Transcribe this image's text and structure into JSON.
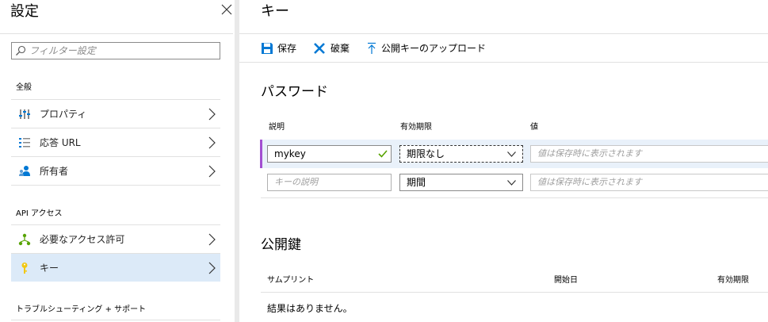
{
  "left_blade": {
    "title": "設定",
    "filter_placeholder": "フィルター設定",
    "sections": [
      {
        "title": "全般",
        "items": [
          {
            "label": "プロパティ",
            "icon": "properties-icon"
          },
          {
            "label": "応答 URL",
            "icon": "list-icon"
          },
          {
            "label": "所有者",
            "icon": "owners-icon"
          }
        ]
      },
      {
        "title": "API アクセス",
        "items": [
          {
            "label": "必要なアクセス許可",
            "icon": "permissions-icon"
          },
          {
            "label": "キー",
            "icon": "key-icon",
            "active": true
          }
        ]
      },
      {
        "title": "トラブルシューティング + サポート",
        "items": []
      }
    ]
  },
  "right_blade": {
    "title": "キー",
    "toolbar": {
      "save_label": "保存",
      "discard_label": "破棄",
      "upload_label": "公開キーのアップロード"
    },
    "passwords": {
      "heading": "パスワード",
      "columns": {
        "description": "説明",
        "expires": "有効期限",
        "value": "値"
      },
      "rows": [
        {
          "description": "mykey",
          "expires": "期限なし",
          "value_placeholder": "値は保存時に表示されます"
        },
        {
          "description_placeholder": "キーの説明",
          "expires": "期間",
          "value_placeholder": "値は保存時に表示されます"
        }
      ]
    },
    "public_keys": {
      "heading": "公開鍵",
      "columns": {
        "thumbprint": "サムプリント",
        "start_date": "開始日",
        "expires": "有効期限"
      },
      "empty_message": "結果はありません。"
    }
  },
  "colors": {
    "accent_blue": "#0078d4",
    "active_row": "#dceaf8",
    "edit_accent": "#a34fd1",
    "check_green": "#57a300"
  }
}
